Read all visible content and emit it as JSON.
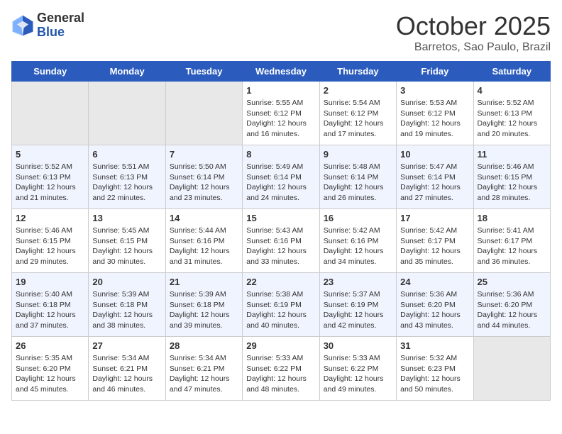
{
  "header": {
    "logo_general": "General",
    "logo_blue": "Blue",
    "month": "October 2025",
    "location": "Barretos, Sao Paulo, Brazil"
  },
  "days_of_week": [
    "Sunday",
    "Monday",
    "Tuesday",
    "Wednesday",
    "Thursday",
    "Friday",
    "Saturday"
  ],
  "weeks": [
    [
      {
        "day": "",
        "empty": true
      },
      {
        "day": "",
        "empty": true
      },
      {
        "day": "",
        "empty": true
      },
      {
        "day": "1",
        "sunrise": "Sunrise: 5:55 AM",
        "sunset": "Sunset: 6:12 PM",
        "daylight": "Daylight: 12 hours and 16 minutes."
      },
      {
        "day": "2",
        "sunrise": "Sunrise: 5:54 AM",
        "sunset": "Sunset: 6:12 PM",
        "daylight": "Daylight: 12 hours and 17 minutes."
      },
      {
        "day": "3",
        "sunrise": "Sunrise: 5:53 AM",
        "sunset": "Sunset: 6:12 PM",
        "daylight": "Daylight: 12 hours and 19 minutes."
      },
      {
        "day": "4",
        "sunrise": "Sunrise: 5:52 AM",
        "sunset": "Sunset: 6:13 PM",
        "daylight": "Daylight: 12 hours and 20 minutes."
      }
    ],
    [
      {
        "day": "5",
        "sunrise": "Sunrise: 5:52 AM",
        "sunset": "Sunset: 6:13 PM",
        "daylight": "Daylight: 12 hours and 21 minutes."
      },
      {
        "day": "6",
        "sunrise": "Sunrise: 5:51 AM",
        "sunset": "Sunset: 6:13 PM",
        "daylight": "Daylight: 12 hours and 22 minutes."
      },
      {
        "day": "7",
        "sunrise": "Sunrise: 5:50 AM",
        "sunset": "Sunset: 6:14 PM",
        "daylight": "Daylight: 12 hours and 23 minutes."
      },
      {
        "day": "8",
        "sunrise": "Sunrise: 5:49 AM",
        "sunset": "Sunset: 6:14 PM",
        "daylight": "Daylight: 12 hours and 24 minutes."
      },
      {
        "day": "9",
        "sunrise": "Sunrise: 5:48 AM",
        "sunset": "Sunset: 6:14 PM",
        "daylight": "Daylight: 12 hours and 26 minutes."
      },
      {
        "day": "10",
        "sunrise": "Sunrise: 5:47 AM",
        "sunset": "Sunset: 6:14 PM",
        "daylight": "Daylight: 12 hours and 27 minutes."
      },
      {
        "day": "11",
        "sunrise": "Sunrise: 5:46 AM",
        "sunset": "Sunset: 6:15 PM",
        "daylight": "Daylight: 12 hours and 28 minutes."
      }
    ],
    [
      {
        "day": "12",
        "sunrise": "Sunrise: 5:46 AM",
        "sunset": "Sunset: 6:15 PM",
        "daylight": "Daylight: 12 hours and 29 minutes."
      },
      {
        "day": "13",
        "sunrise": "Sunrise: 5:45 AM",
        "sunset": "Sunset: 6:15 PM",
        "daylight": "Daylight: 12 hours and 30 minutes."
      },
      {
        "day": "14",
        "sunrise": "Sunrise: 5:44 AM",
        "sunset": "Sunset: 6:16 PM",
        "daylight": "Daylight: 12 hours and 31 minutes."
      },
      {
        "day": "15",
        "sunrise": "Sunrise: 5:43 AM",
        "sunset": "Sunset: 6:16 PM",
        "daylight": "Daylight: 12 hours and 33 minutes."
      },
      {
        "day": "16",
        "sunrise": "Sunrise: 5:42 AM",
        "sunset": "Sunset: 6:16 PM",
        "daylight": "Daylight: 12 hours and 34 minutes."
      },
      {
        "day": "17",
        "sunrise": "Sunrise: 5:42 AM",
        "sunset": "Sunset: 6:17 PM",
        "daylight": "Daylight: 12 hours and 35 minutes."
      },
      {
        "day": "18",
        "sunrise": "Sunrise: 5:41 AM",
        "sunset": "Sunset: 6:17 PM",
        "daylight": "Daylight: 12 hours and 36 minutes."
      }
    ],
    [
      {
        "day": "19",
        "sunrise": "Sunrise: 5:40 AM",
        "sunset": "Sunset: 6:18 PM",
        "daylight": "Daylight: 12 hours and 37 minutes."
      },
      {
        "day": "20",
        "sunrise": "Sunrise: 5:39 AM",
        "sunset": "Sunset: 6:18 PM",
        "daylight": "Daylight: 12 hours and 38 minutes."
      },
      {
        "day": "21",
        "sunrise": "Sunrise: 5:39 AM",
        "sunset": "Sunset: 6:18 PM",
        "daylight": "Daylight: 12 hours and 39 minutes."
      },
      {
        "day": "22",
        "sunrise": "Sunrise: 5:38 AM",
        "sunset": "Sunset: 6:19 PM",
        "daylight": "Daylight: 12 hours and 40 minutes."
      },
      {
        "day": "23",
        "sunrise": "Sunrise: 5:37 AM",
        "sunset": "Sunset: 6:19 PM",
        "daylight": "Daylight: 12 hours and 42 minutes."
      },
      {
        "day": "24",
        "sunrise": "Sunrise: 5:36 AM",
        "sunset": "Sunset: 6:20 PM",
        "daylight": "Daylight: 12 hours and 43 minutes."
      },
      {
        "day": "25",
        "sunrise": "Sunrise: 5:36 AM",
        "sunset": "Sunset: 6:20 PM",
        "daylight": "Daylight: 12 hours and 44 minutes."
      }
    ],
    [
      {
        "day": "26",
        "sunrise": "Sunrise: 5:35 AM",
        "sunset": "Sunset: 6:20 PM",
        "daylight": "Daylight: 12 hours and 45 minutes."
      },
      {
        "day": "27",
        "sunrise": "Sunrise: 5:34 AM",
        "sunset": "Sunset: 6:21 PM",
        "daylight": "Daylight: 12 hours and 46 minutes."
      },
      {
        "day": "28",
        "sunrise": "Sunrise: 5:34 AM",
        "sunset": "Sunset: 6:21 PM",
        "daylight": "Daylight: 12 hours and 47 minutes."
      },
      {
        "day": "29",
        "sunrise": "Sunrise: 5:33 AM",
        "sunset": "Sunset: 6:22 PM",
        "daylight": "Daylight: 12 hours and 48 minutes."
      },
      {
        "day": "30",
        "sunrise": "Sunrise: 5:33 AM",
        "sunset": "Sunset: 6:22 PM",
        "daylight": "Daylight: 12 hours and 49 minutes."
      },
      {
        "day": "31",
        "sunrise": "Sunrise: 5:32 AM",
        "sunset": "Sunset: 6:23 PM",
        "daylight": "Daylight: 12 hours and 50 minutes."
      },
      {
        "day": "",
        "empty": true
      }
    ]
  ]
}
